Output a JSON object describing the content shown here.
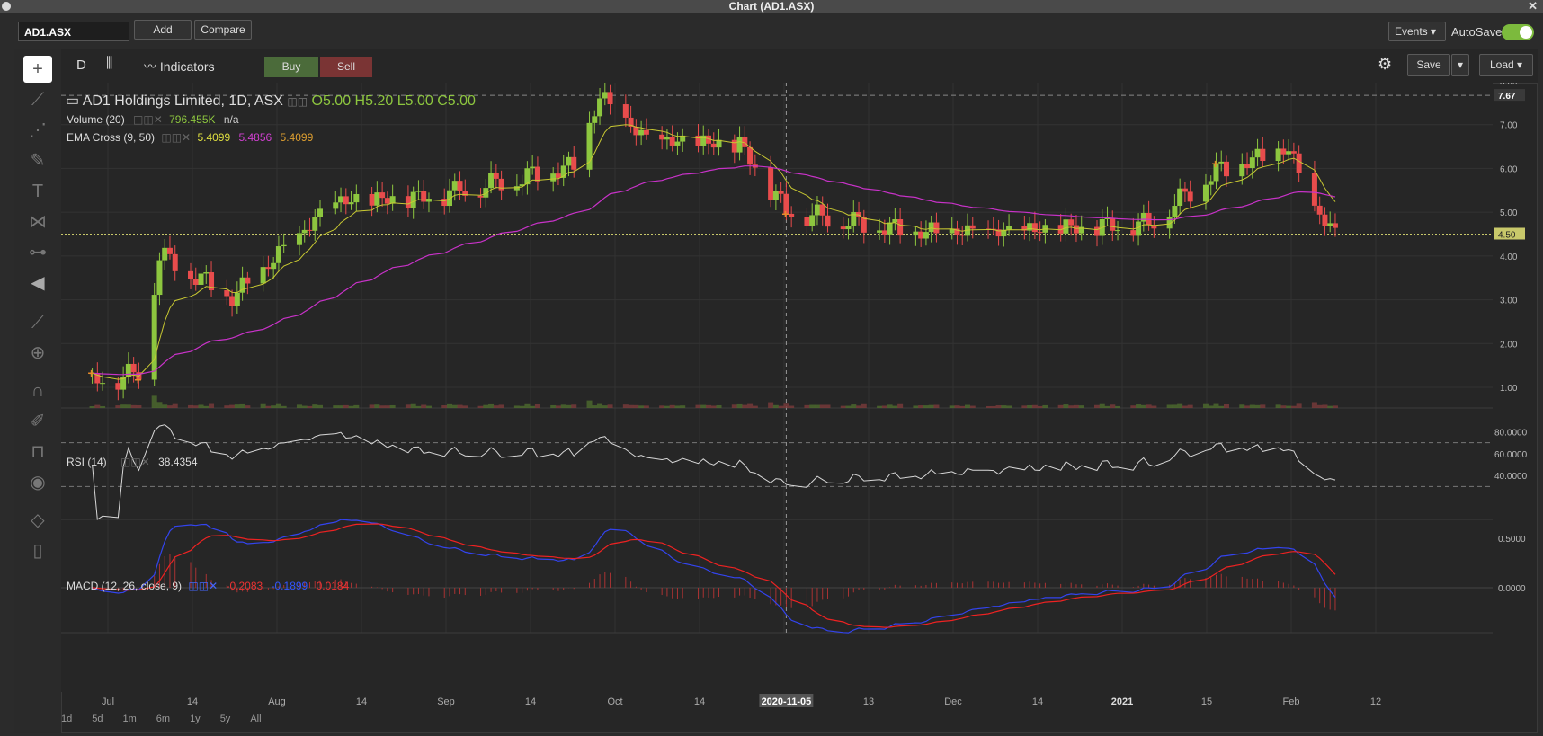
{
  "window": {
    "title": "Chart (AD1.ASX)"
  },
  "toolbar": {
    "symbol": "AD1.ASX",
    "add_label": "Add",
    "compare_label": "Compare",
    "events_label": "Events",
    "autosave_label": "AutoSave",
    "autosave_on": true
  },
  "chart_toolbar": {
    "interval": "D",
    "indicators_label": "Indicators",
    "buy_label": "Buy",
    "sell_label": "Sell",
    "save_label": "Save",
    "load_label": "Load"
  },
  "colors": {
    "up": "#8dc63f",
    "down": "#e84c4c",
    "ema_fast": "#c8c832",
    "ema_slow": "#c832c8",
    "macd": "#3344ee",
    "signal": "#ee2222",
    "accent": "#7cba3d"
  },
  "legend": {
    "name": "AD1 Holdings Limited, 1D, ASX",
    "open": "O5.00",
    "high": "H5.20",
    "low": "L5.00",
    "close": "C5.00",
    "volume_label": "Volume (20)",
    "volume_value": "796.455K",
    "volume_value2": "n/a",
    "ema_label": "EMA Cross (9, 50)",
    "ema_v1": "5.4099",
    "ema_v2": "5.4856",
    "ema_v3": "5.4099",
    "rsi_label": "RSI (14)",
    "rsi_value": "38.4354",
    "macd_label": "MACD (12, 26, close, 9)",
    "macd_v1": "-0.2083",
    "macd_v2": "-0.1899",
    "macd_v3": "0.0184"
  },
  "price_axis": {
    "ticks": [
      "8.00",
      "7.00",
      "6.00",
      "5.00",
      "4.00",
      "3.00",
      "2.00",
      "1.00"
    ],
    "high_marker": "7.67",
    "last_marker": "4.50"
  },
  "rsi_axis": {
    "ticks": [
      "80.0000",
      "60.0000",
      "40.0000"
    ]
  },
  "macd_axis": {
    "ticks": [
      "0.5000",
      "0.0000"
    ]
  },
  "time_axis": {
    "labels": [
      "Jul",
      "14",
      "Aug",
      "14",
      "Sep",
      "14",
      "Oct",
      "14",
      "Nov",
      "13",
      "Dec",
      "14",
      "2021",
      "15",
      "Feb",
      "12"
    ],
    "crosshair_label": "2020-11-05"
  },
  "periods": [
    "1d",
    "5d",
    "1m",
    "6m",
    "1y",
    "5y",
    "All"
  ],
  "chart_data": {
    "type": "candlestick",
    "title": "AD1 Holdings Limited, 1D, ASX",
    "ylim": [
      0.6,
      8.3
    ],
    "x_range": [
      "2020-06-18",
      "2021-02-23"
    ],
    "ohlc_key_points": [
      {
        "date": "2020-06-24",
        "close": 1.1
      },
      {
        "date": "2020-07-03",
        "close": 1.3
      },
      {
        "date": "2020-07-07",
        "close": 4.0
      },
      {
        "date": "2020-07-21",
        "close": 3.0
      },
      {
        "date": "2020-08-10",
        "close": 5.2
      },
      {
        "date": "2020-08-27",
        "close": 5.3
      },
      {
        "date": "2020-09-25",
        "close": 6.0
      },
      {
        "date": "2020-09-30",
        "close": 7.6
      },
      {
        "date": "2020-10-09",
        "close": 6.6
      },
      {
        "date": "2020-10-27",
        "close": 6.5
      },
      {
        "date": "2020-11-05",
        "close": 5.0
      },
      {
        "date": "2020-11-30",
        "close": 4.5
      },
      {
        "date": "2020-12-15",
        "close": 4.5
      },
      {
        "date": "2021-01-14",
        "close": 4.7
      },
      {
        "date": "2021-01-27",
        "close": 5.9
      },
      {
        "date": "2021-02-10",
        "close": 6.4
      },
      {
        "date": "2021-02-15",
        "close": 5.0
      },
      {
        "date": "2021-02-19",
        "close": 4.5
      }
    ],
    "series": [
      {
        "name": "EMA Cross (9, 50)",
        "last": 5.4099
      },
      {
        "name": "Volume (20)",
        "last": "796.455K"
      },
      {
        "name": "RSI (14)",
        "last": 38.4354
      },
      {
        "name": "MACD (12, 26, close, 9)",
        "last": -0.2083
      }
    ],
    "rsi_levels": [
      70,
      30
    ]
  }
}
